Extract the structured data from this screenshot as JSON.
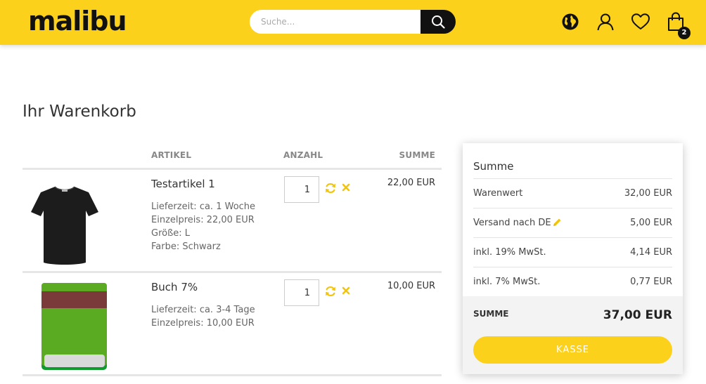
{
  "header": {
    "logo": "malibu",
    "search_placeholder": "Suche...",
    "cart_count": "2"
  },
  "page": {
    "title": "Ihr Warenkorb"
  },
  "cart": {
    "columns": {
      "article": "ARTIKEL",
      "quantity": "ANZAHL",
      "sum": "SUMME"
    },
    "items": [
      {
        "name": "Testartikel 1",
        "meta": [
          "Lieferzeit: ca. 1 Woche",
          "Einzelpreis: 22,00 EUR",
          "Größe: L",
          "Farbe: Schwarz"
        ],
        "quantity": "1",
        "sum": "22,00 EUR"
      },
      {
        "name": "Buch 7%",
        "meta": [
          "Lieferzeit: ca. 3-4 Tage",
          "Einzelpreis: 10,00 EUR"
        ],
        "quantity": "1",
        "sum": "10,00 EUR"
      }
    ]
  },
  "summary": {
    "title": "Summe",
    "lines": [
      {
        "label": "Warenwert",
        "value": "32,00 EUR"
      },
      {
        "label": "Versand nach DE",
        "value": "5,00 EUR"
      },
      {
        "label": "inkl. 19% MwSt.",
        "value": "4,14 EUR"
      },
      {
        "label": "inkl. 7% MwSt.",
        "value": "0,77 EUR"
      }
    ],
    "total_label": "SUMME",
    "total_value": "37,00 EUR",
    "checkout_label": "KASSE"
  },
  "colors": {
    "brand_yellow": "#fcd11b",
    "dark": "#111111",
    "refresh_green": "#f1c40f"
  }
}
